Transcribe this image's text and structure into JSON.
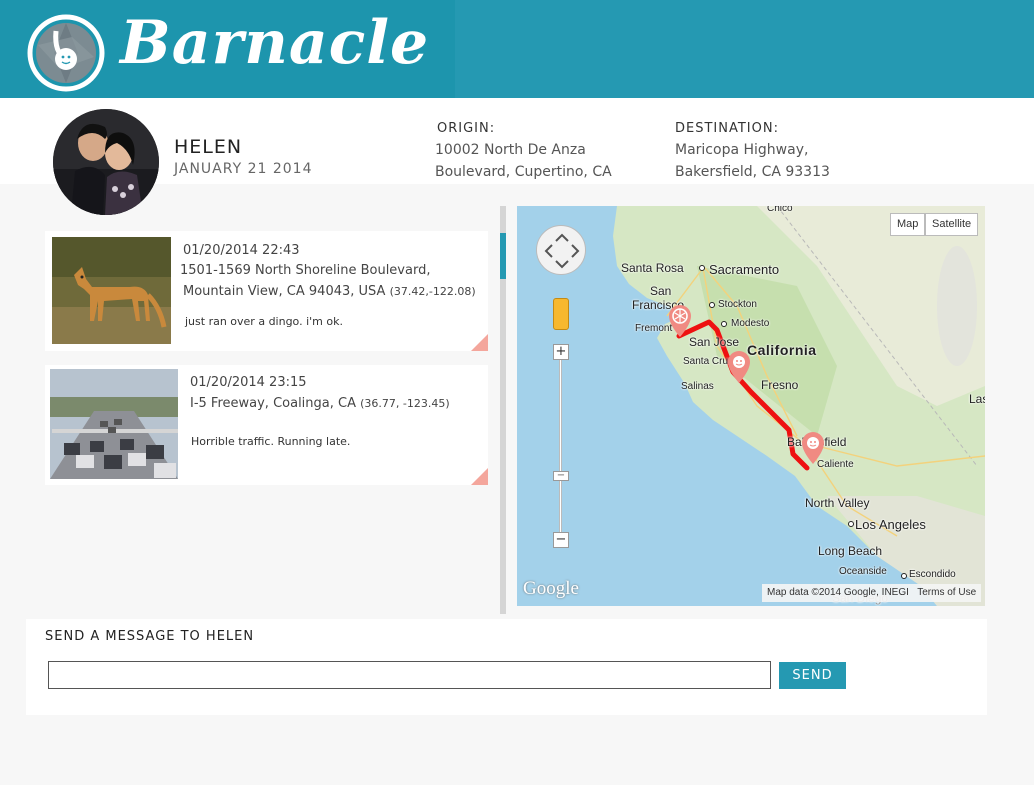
{
  "header": {
    "brand": "Barnacle",
    "logo_icon": "barnacle-aperture-logo",
    "accent_color": "#2599b2"
  },
  "profile": {
    "name": "HELEN",
    "date": "JANUARY 21 2014",
    "origin_label": "ORIGIN:",
    "origin_line1": "10002 North De Anza",
    "origin_line2": "Boulevard, Cupertino, CA",
    "destination_label": "DESTINATION:",
    "destination_line1": "Maricopa Highway,",
    "destination_line2": "Bakersfield, CA 93313"
  },
  "feed": [
    {
      "time": "01/20/2014 22:43",
      "address_line1": "1501-1569 North Shoreline Boulevard,",
      "address_line2": "Mountain View, CA 94043, USA",
      "coords": "(37.42,-122.08)",
      "message": "just ran over a dingo. i'm ok.",
      "image": "dingo-photo"
    },
    {
      "time": "01/20/2014 23:15",
      "address_line1": "I-5 Freeway, Coalinga, CA",
      "address_line2": "",
      "coords": "(36.77, -123.45)",
      "message": "Horrible traffic. Running late.",
      "image": "freeway-traffic-photo"
    }
  ],
  "map": {
    "type_map": "Map",
    "type_satellite": "Satellite",
    "google": "Google",
    "attribution": "Map data ©2014 Google, INEGI",
    "terms": "Terms of Use",
    "route_color": "#ee1111",
    "labels": {
      "chico": "Chico",
      "santa_rosa": "Santa Rosa",
      "sacramento": "Sacramento",
      "san_francisco_1": "San",
      "san_francisco_2": "Francisco",
      "stockton": "Stockton",
      "fremont": "Fremont",
      "modesto": "Modesto",
      "san_jose": "San Jose",
      "california": "California",
      "santa_cruz": "Santa Cruz",
      "salinas": "Salinas",
      "fresno": "Fresno",
      "bakersfield": "Bakersfield",
      "caliente": "Caliente",
      "las": "Las",
      "north_valley": "North Valley",
      "los_angeles": "Los Angeles",
      "long_beach": "Long Beach",
      "oceanside": "Oceanside",
      "escondido": "Escondido",
      "san_diego": "San Diego"
    }
  },
  "message": {
    "title": "SEND A MESSAGE TO HELEN",
    "input_value": "",
    "input_placeholder": "",
    "send_label": "SEND"
  }
}
